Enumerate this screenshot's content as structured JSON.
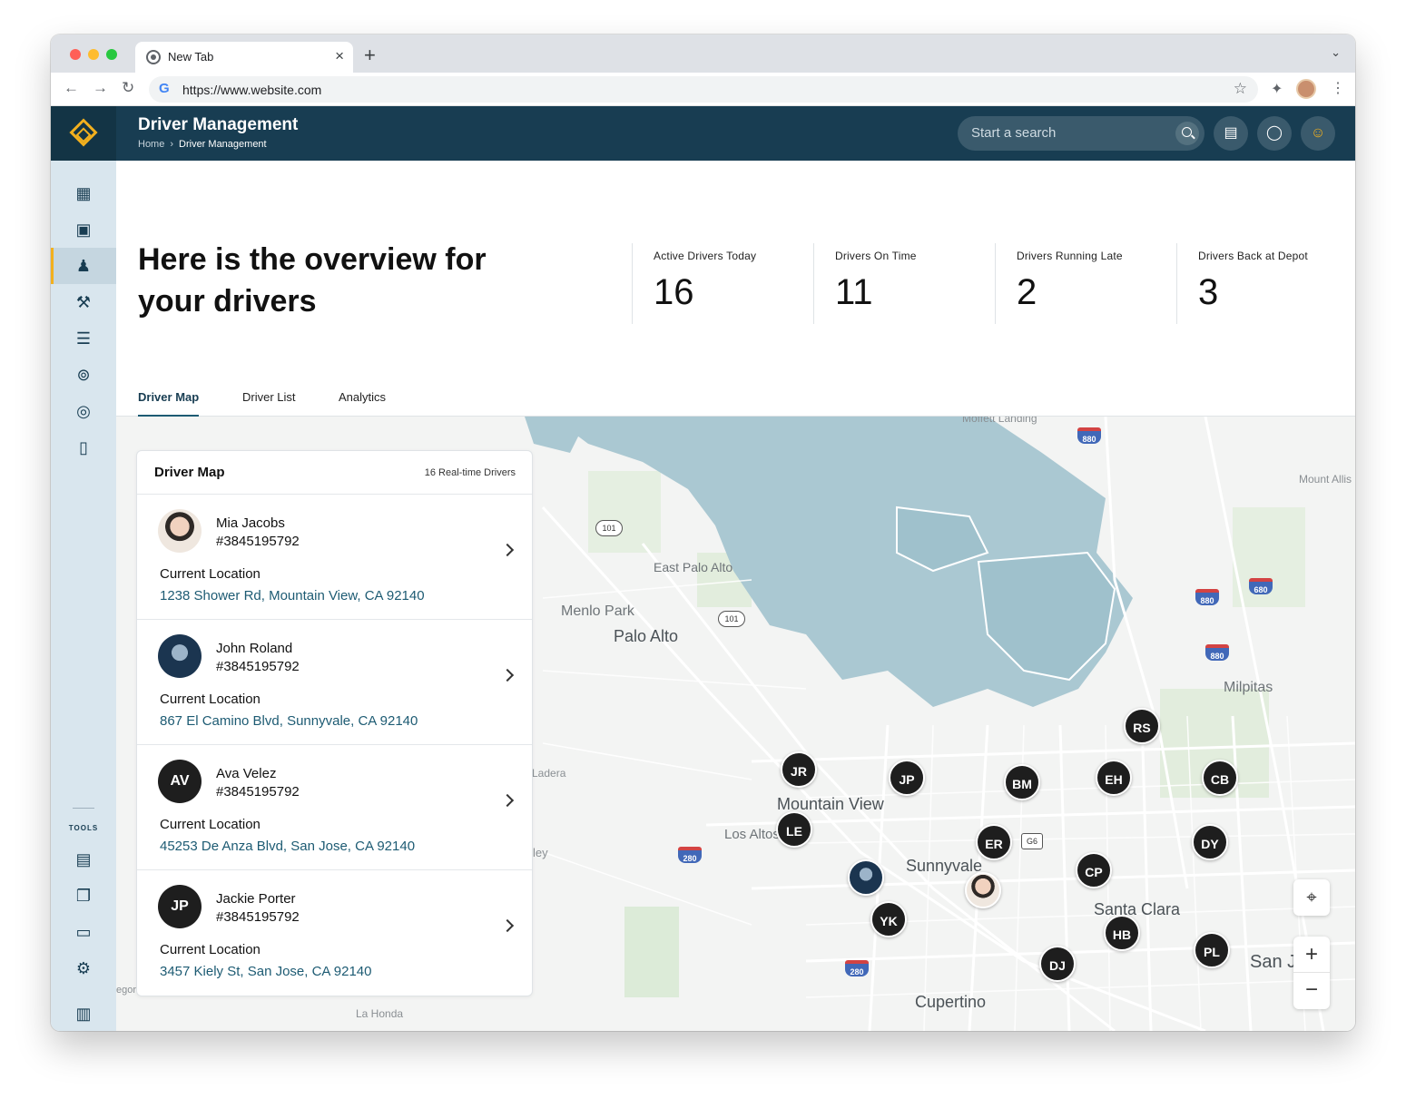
{
  "browser": {
    "tab_title": "New Tab",
    "tab_close": "×",
    "new_tab": "+",
    "url": "https://www.website.com",
    "back": "←",
    "forward": "→",
    "reload": "↻",
    "star": "☆",
    "extensions": "✦",
    "menu": "⋮",
    "tab_menu": "⌄"
  },
  "header": {
    "title": "Driver Management",
    "breadcrumb": [
      "Home",
      "Driver Management"
    ],
    "breadcrumb_sep": "›",
    "search_placeholder": "Start a search",
    "chat_icon": "▤",
    "bell_icon": "🔔",
    "user_icon": "◯"
  },
  "sidebar": {
    "tools_label": "TOOLS",
    "items": [
      {
        "icon": "▦",
        "name": "dashboard-icon"
      },
      {
        "icon": "▣",
        "name": "bus-icon"
      },
      {
        "icon": "♟",
        "name": "driver-icon"
      },
      {
        "icon": "⚒",
        "name": "tools-icon"
      },
      {
        "icon": "☰",
        "name": "list-icon"
      },
      {
        "icon": "⊚",
        "name": "signal-icon"
      },
      {
        "icon": "◎",
        "name": "gauge-icon"
      },
      {
        "icon": "▯",
        "name": "door-icon"
      }
    ],
    "tools": [
      {
        "icon": "▤",
        "name": "document-icon"
      },
      {
        "icon": "❐",
        "name": "copy-icon"
      },
      {
        "icon": "▭",
        "name": "card-icon"
      },
      {
        "icon": "⚙",
        "name": "settings-icon"
      },
      {
        "icon": "▥",
        "name": "collapse-icon"
      }
    ]
  },
  "overview": {
    "title": "Here is the overview for your drivers",
    "stats": [
      {
        "label": "Active Drivers Today",
        "value": "16"
      },
      {
        "label": "Drivers On Time",
        "value": "11"
      },
      {
        "label": "Drivers Running Late",
        "value": "2"
      },
      {
        "label": "Drivers Back at Depot",
        "value": "3"
      }
    ]
  },
  "tabs": [
    "Driver Map",
    "Driver List",
    "Analytics"
  ],
  "panel": {
    "title": "Driver Map",
    "count": "16 Real-time Drivers",
    "location_label": "Current Location",
    "drivers": [
      {
        "name": "Mia Jacobs",
        "id": "#3845195792",
        "initials": "",
        "address": "1238 Shower Rd, Mountain View, CA 92140"
      },
      {
        "name": "John Roland",
        "id": "#3845195792",
        "initials": "",
        "address": "867 El Camino Blvd, Sunnyvale, CA 92140"
      },
      {
        "name": "Ava Velez",
        "id": "#3845195792",
        "initials": "AV",
        "address": "45253 De Anza Blvd, San Jose, CA 92140"
      },
      {
        "name": "Jackie Porter",
        "id": "#3845195792",
        "initials": "JP",
        "address": "3457 Kiely St, San Jose, CA 92140"
      }
    ]
  },
  "map": {
    "water_color": "#aac8d2",
    "labels": [
      "Moffett Landing",
      "Mount Allis",
      "East Palo Alto",
      "Menlo Park",
      "Palo Alto",
      "Milpitas",
      "Ladera",
      "Mountain View",
      "Los Altos",
      "Sunnyvale",
      "Santa Clara",
      "San J",
      "Cupertino",
      "La Honda",
      "ley",
      "egor"
    ],
    "highways": [
      "880",
      "880",
      "680",
      "880",
      "101",
      "101",
      "280",
      "280",
      "G6"
    ],
    "markers": [
      "RS",
      "JR",
      "JP",
      "BM",
      "EH",
      "CB",
      "LE",
      "ER",
      "DY",
      "CP",
      "YK",
      "HB",
      "PL",
      "DJ"
    ],
    "controls": {
      "zoom_in": "+",
      "zoom_out": "−",
      "locate": "⌖"
    }
  }
}
